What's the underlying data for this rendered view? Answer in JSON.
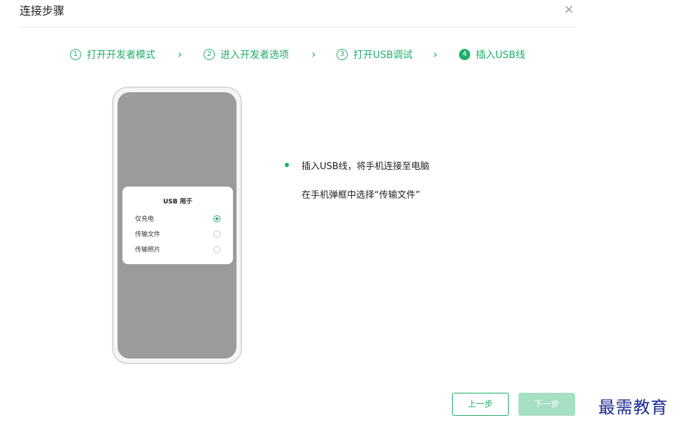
{
  "dialog": {
    "title": "连接步骤",
    "close_symbol": "×"
  },
  "steps": [
    {
      "num": "1",
      "label": "打开开发者模式",
      "active": false
    },
    {
      "num": "2",
      "label": "进入开发者选项",
      "active": false
    },
    {
      "num": "3",
      "label": "打开USB调试",
      "active": false
    },
    {
      "num": "4",
      "label": "插入USB线",
      "active": true
    }
  ],
  "step_separator": "›",
  "phone": {
    "usb_dialog": {
      "title": "USB 用于",
      "options": [
        {
          "label": "仅充电",
          "selected": true
        },
        {
          "label": "传输文件",
          "selected": false
        },
        {
          "label": "传输照片",
          "selected": false
        }
      ]
    }
  },
  "instructions": {
    "line1": "插入USB线，将手机连接至电脑",
    "line2": "在手机弹框中选择“传输文件”"
  },
  "buttons": {
    "prev_label": "上一步",
    "next_label": "下一步"
  },
  "watermark": "最需教育",
  "colors": {
    "accent": "#1fae6a",
    "accent_disabled": "#a6e0c4",
    "phone_screen": "#9b9b9b"
  }
}
